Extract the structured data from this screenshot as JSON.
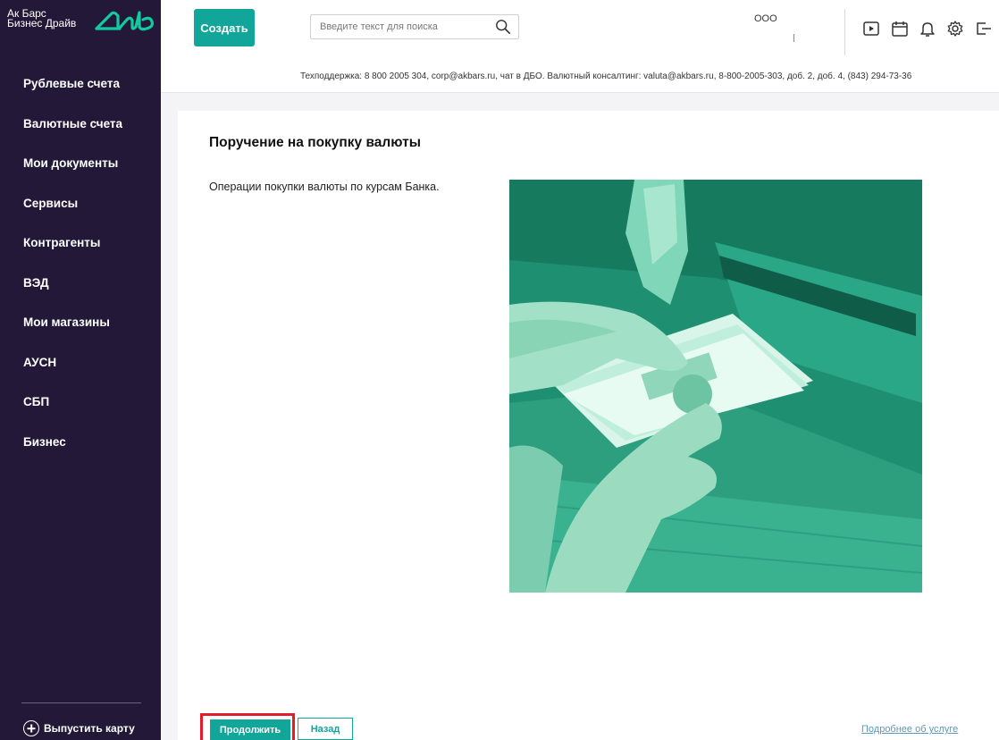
{
  "brand": {
    "line1": "Ак Барс",
    "line2": "Бизнес Драйв",
    "accent": "#12a69a"
  },
  "sidebar": {
    "items": [
      {
        "label": "Рублевые счета"
      },
      {
        "label": "Валютные счета"
      },
      {
        "label": "Мои документы"
      },
      {
        "label": "Сервисы"
      },
      {
        "label": "Контрагенты"
      },
      {
        "label": "ВЭД"
      },
      {
        "label": "Мои магазины"
      },
      {
        "label": "АУСН"
      },
      {
        "label": "СБП"
      },
      {
        "label": "Бизнес"
      }
    ],
    "issue_card_label": "Выпустить карту"
  },
  "header": {
    "create_label": "Создать",
    "search_placeholder": "Введите текст для поиска",
    "org_name": "ООО",
    "icons": [
      "play-icon",
      "calendar-icon",
      "bell-icon",
      "gear-icon",
      "logout-icon"
    ],
    "support_text": "Техподдержка: 8 800 2005 304, corp@akbars.ru, чат в ДБО. Валютный консалтинг: valuta@akbars.ru, 8-800-2005-303, доб. 2, доб. 4, (843) 294-73-36"
  },
  "main": {
    "title": "Поручение на покупку валюты",
    "description": "Операции покупки валюты по курсам Банка.",
    "continue_label": "Продолжить",
    "back_label": "Назад",
    "more_link": "Подробнее об услуге"
  }
}
